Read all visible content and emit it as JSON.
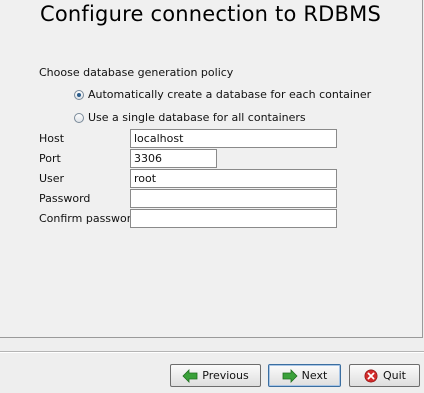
{
  "title": "Configure connection to RDBMS",
  "policy": {
    "label": "Choose database generation policy",
    "options": [
      {
        "label": "Automatically create a database for each container",
        "selected": true
      },
      {
        "label": "Use a single database for all containers",
        "selected": false
      }
    ]
  },
  "fields": {
    "host": {
      "label": "Host",
      "value": "localhost"
    },
    "port": {
      "label": "Port",
      "value": "3306"
    },
    "user": {
      "label": "User",
      "value": "root"
    },
    "password": {
      "label": "Password",
      "value": ""
    },
    "confirm": {
      "label": "Confirm password",
      "value": ""
    }
  },
  "buttons": {
    "previous": "Previous",
    "next": "Next",
    "quit": "Quit"
  },
  "colors": {
    "arrow_green": "#3aa13a",
    "quit_red": "#d22a2a"
  },
  "icons": {
    "previous": "arrow-left-icon",
    "next": "arrow-right-icon",
    "quit": "close-circle-icon"
  }
}
